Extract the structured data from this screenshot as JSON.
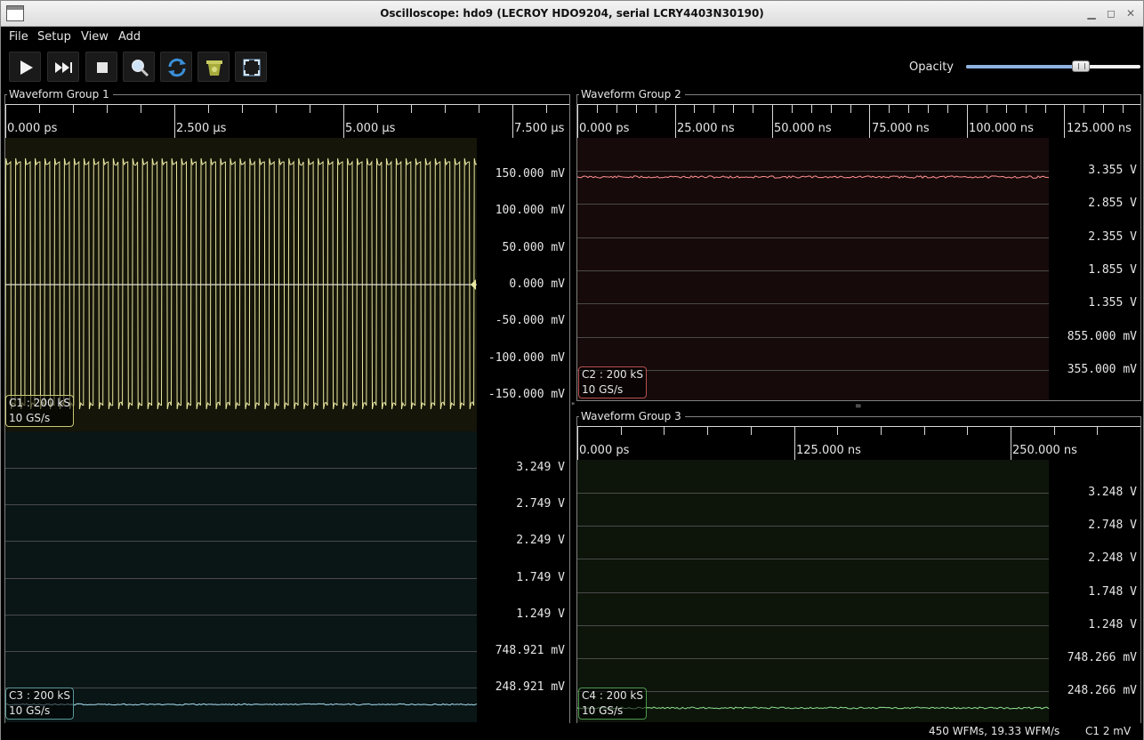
{
  "window": {
    "title": "Oscilloscope: hdo9 (LECROY HDO9204, serial LCRY4403N30190)",
    "buttons": [
      "minimize",
      "maximize",
      "close"
    ]
  },
  "menu": {
    "file": "File",
    "setup": "Setup",
    "view": "View",
    "add": "Add"
  },
  "toolbar": {
    "buttons": [
      "play-icon",
      "single-trigger-icon",
      "stop-icon",
      "zoom-icon",
      "refresh-icon",
      "clear-sweeps-icon",
      "fullscreen-icon"
    ],
    "opacity_label": "Opacity",
    "opacity_value": 0.66
  },
  "groups": {
    "g1": {
      "label": "Waveform Group 1",
      "ticks": [
        "0.000 ps",
        "2.500 µs",
        "5.000 µs",
        "7.500 µs"
      ]
    },
    "g2": {
      "label": "Waveform Group 2",
      "ticks": [
        "0.000 ps",
        "25.000 ns",
        "50.000 ns",
        "75.000 ns",
        "100.000 ns",
        "125.000 ns"
      ]
    },
    "g3": {
      "label": "Waveform Group 3",
      "ticks": [
        "0.000 ps",
        "125.000 ns",
        "250.000 ns"
      ]
    }
  },
  "channels": {
    "c1": {
      "name": "C1 : 200 kS",
      "rate": "10 GS/s",
      "color": "#e8e6a0",
      "yaxis": [
        "150.000 mV",
        "100.000 mV",
        "50.000 mV",
        "0.000 mV",
        "-50.000 mV",
        "-100.000 mV",
        "-150.000 mV"
      ]
    },
    "c2": {
      "name": "C2 : 200 kS",
      "rate": "10 GS/s",
      "color": "#ff9090",
      "yaxis": [
        "3.355 V",
        "2.855 V",
        "2.355 V",
        "1.855 V",
        "1.355 V",
        "855.000 mV",
        "355.000 mV"
      ]
    },
    "c3": {
      "name": "C3 : 200 kS",
      "rate": "10 GS/s",
      "color": "#a8e0f0",
      "yaxis": [
        "3.249 V",
        "2.749 V",
        "2.249 V",
        "1.749 V",
        "1.249 V",
        "748.921 mV",
        "248.921 mV"
      ]
    },
    "c4": {
      "name": "C4 : 200 kS",
      "rate": "10 GS/s",
      "color": "#90e090",
      "yaxis": [
        "3.248 V",
        "2.748 V",
        "2.248 V",
        "1.748 V",
        "1.248 V",
        "748.266 mV",
        "248.266 mV"
      ]
    }
  },
  "status": {
    "wfms": "450 WFMs, 19.33 WFM/s",
    "trigger": "C1 2 mV"
  }
}
